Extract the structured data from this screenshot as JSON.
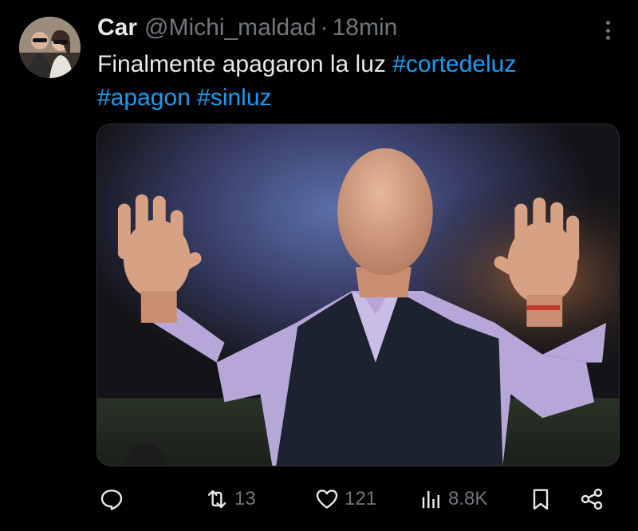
{
  "tweet": {
    "author_name": "Car",
    "author_handle": "@Michi_maldad",
    "separator": "·",
    "time": "18min",
    "text_plain": "Finalmente apagaron la luz ",
    "hashtags": [
      "#cortedeluz",
      "#apagon",
      "#sinluz"
    ]
  },
  "actions": {
    "reply_count": "",
    "retweet_count": "13",
    "like_count": "121",
    "views_count": "8.8K"
  },
  "icons": {
    "more": "more-dots-icon",
    "reply": "reply-icon",
    "retweet": "retweet-icon",
    "like": "heart-icon",
    "views": "views-icon",
    "bookmark": "bookmark-icon",
    "share": "share-icon"
  },
  "colors": {
    "background": "#000000",
    "text": "#e7e9ea",
    "muted": "#71767b",
    "accent": "#1d9bf0"
  }
}
